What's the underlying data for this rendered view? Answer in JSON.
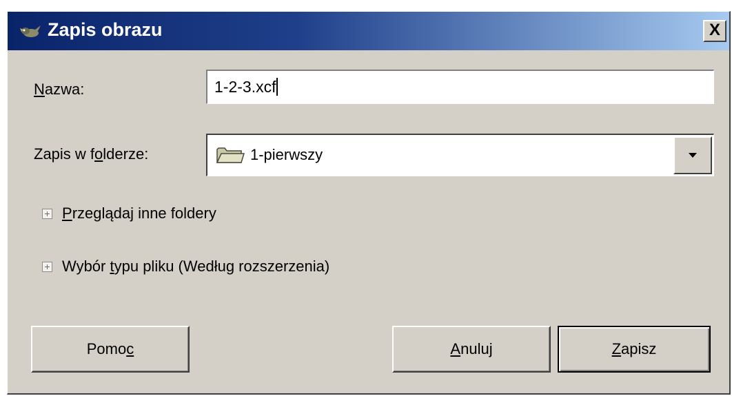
{
  "window": {
    "title": "Zapis obrazu",
    "close_symbol": "X",
    "app_icon": "gimp-wilber-icon"
  },
  "form": {
    "name_label": {
      "mnemonic": "N",
      "rest": "azwa:"
    },
    "name_value": "1-2-3.xcf",
    "folder_label": {
      "before": "Zapis w f",
      "mnemonic": "o",
      "after": "lderze:"
    },
    "folder_value": "1-pierwszy",
    "folder_icon": "folder-icon",
    "dropdown_icon": "chevron-down-icon"
  },
  "expanders": {
    "browse": {
      "mnemonic": "P",
      "rest": "rzeglądaj inne foldery"
    },
    "file_type": {
      "before": "Wybór ",
      "mnemonic": "t",
      "after": "ypu pliku (Według rozszerzenia)"
    }
  },
  "buttons": {
    "help": {
      "before": "Pomo",
      "mnemonic": "c",
      "after": ""
    },
    "cancel": {
      "before": "",
      "mnemonic": "A",
      "after": "nuluj"
    },
    "save": {
      "before": "",
      "mnemonic": "Z",
      "after": "apisz"
    }
  },
  "colors": {
    "title_gradient_start": "#0a246a",
    "title_gradient_end": "#a6caf0",
    "dialog_background": "#d4d0c8"
  }
}
